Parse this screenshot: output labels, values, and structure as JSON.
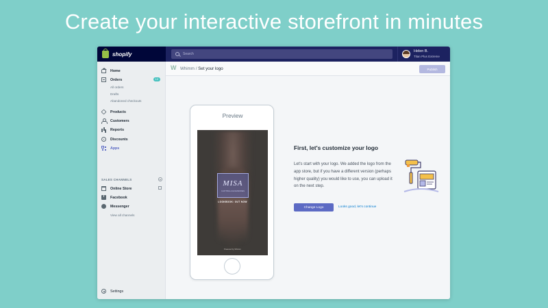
{
  "headline": "Create your interactive storefront in minutes",
  "brand": {
    "name": "shopify",
    "icon": "shopping-bag-icon",
    "color": "#95bf47"
  },
  "search": {
    "placeholder": "Search"
  },
  "user": {
    "name": "Helen B.",
    "plan": "Titan Plus Extreme"
  },
  "sidebar": {
    "items": [
      {
        "label": "Home",
        "icon": "home-icon"
      },
      {
        "label": "Orders",
        "icon": "orders-icon",
        "badge": "12"
      },
      {
        "label": "Products",
        "icon": "tag-icon"
      },
      {
        "label": "Customers",
        "icon": "person-icon"
      },
      {
        "label": "Reports",
        "icon": "bar-chart-icon"
      },
      {
        "label": "Discounts",
        "icon": "discount-icon"
      },
      {
        "label": "Apps",
        "icon": "apps-icon",
        "active": true
      }
    ],
    "order_subitems": [
      "All orders",
      "Drafts",
      "Abandoned checkouts"
    ],
    "sales_channels": {
      "title": "SALES CHANNELS",
      "items": [
        {
          "label": "Online Store",
          "icon": "store-icon"
        },
        {
          "label": "Facebook",
          "icon": "facebook-icon"
        },
        {
          "label": "Messenger",
          "icon": "messenger-icon"
        }
      ],
      "view_all": "View all channels"
    },
    "settings": {
      "label": "Settings",
      "icon": "gear-icon"
    }
  },
  "header": {
    "app_logo": "W",
    "app_name": "Whimm",
    "separator": "/",
    "current": "Set your logo",
    "publish_label": "Publish"
  },
  "preview": {
    "label": "Preview",
    "logo_text": "MISA",
    "logo_subtext": "CLOTHING & ACCESSORIES",
    "lookbook_text": "LOOKBOOK: OUT NOW",
    "powered_by": "Powered by Whimm"
  },
  "content": {
    "title": "First, let's customize your logo",
    "body": "Let's start with your logo.  We added the logo from the app store, but if you have a different version (perhaps higher quality) you would like to use, you can upload it on the next step.",
    "primary_button": "Change Logo",
    "secondary_link": "Looks good, let's continue"
  },
  "colors": {
    "background": "#7fcfc9",
    "topbar": "#1c2260",
    "primary": "#5c6ac4",
    "link": "#007ace",
    "badge": "#47c1bf"
  }
}
